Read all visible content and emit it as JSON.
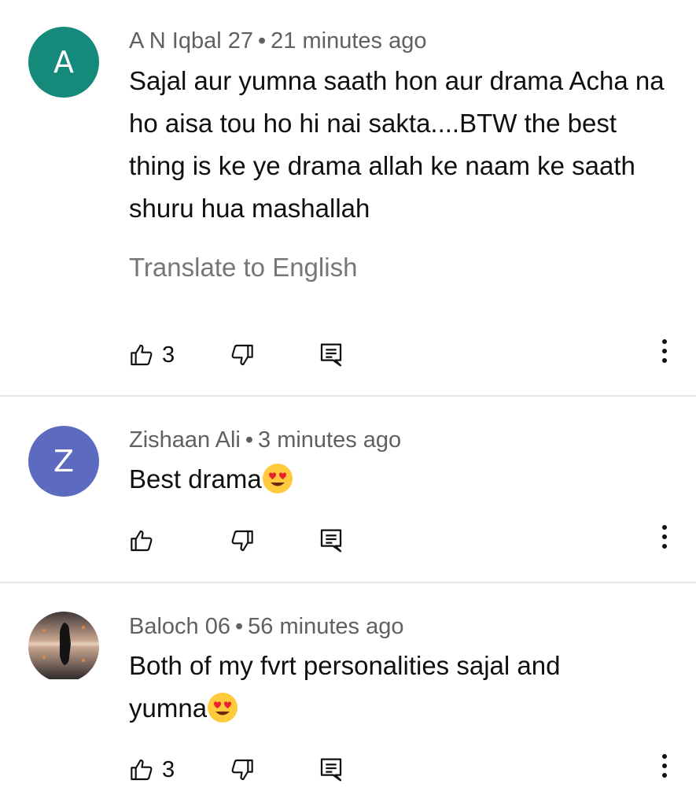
{
  "comments": [
    {
      "avatar_letter": "A",
      "avatar_color": "#15897a",
      "author": "A N Iqbal 27",
      "separator": "•",
      "time": "21 minutes ago",
      "text": "Sajal aur yumna saath hon aur drama Acha na ho aisa tou ho hi nai sakta....BTW the best thing is ke ye drama allah ke naam ke saath shuru hua mashallah",
      "translate_label": "Translate to English",
      "like_count": "3"
    },
    {
      "avatar_letter": "Z",
      "avatar_color": "#5c6bc0",
      "author": "Zishaan Ali",
      "separator": "•",
      "time": "3 minutes ago",
      "text": "Best drama",
      "emoji": "heart-eyes-emoji",
      "like_count": ""
    },
    {
      "avatar_image": "silhouette-reflection-photo",
      "author": "Baloch 06",
      "separator": "•",
      "time": "56 minutes ago",
      "text": "Both of my fvrt personalities sajal and yumna",
      "emoji": "heart-eyes-emoji",
      "like_count": "3"
    }
  ],
  "icons": {
    "like": "thumbs-up-icon",
    "dislike": "thumbs-down-icon",
    "reply": "reply-icon",
    "more": "more-vertical-icon"
  }
}
